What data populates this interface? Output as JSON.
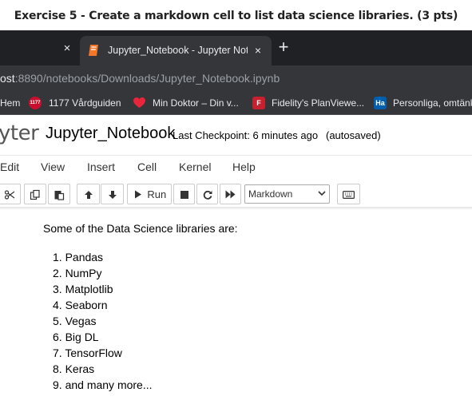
{
  "exercise": {
    "heading": "Exercise 5 - Create a markdown cell to list data science libraries. (3 pts)"
  },
  "browser": {
    "prev_tab_close": "×",
    "active_tab": {
      "title": "Jupyter_Notebook - Jupyter Note",
      "close": "×"
    },
    "new_tab": "+",
    "address": {
      "host": "ost",
      "path": ":8890/notebooks/Downloads/Jupyter_Notebook.ipynb"
    },
    "bookmarks": [
      {
        "label": "Hem",
        "icon": "home-icon"
      },
      {
        "label": "1177 Vårdguiden",
        "icon": "1177-logo-icon",
        "icon_text": "1177",
        "color": "#c8102e"
      },
      {
        "label": "Min Doktor – Din v...",
        "icon": "heart-icon",
        "color": "#e8253a"
      },
      {
        "label": "Fidelity's PlanViewe...",
        "icon": "fidelity-f-icon",
        "icon_text": "F",
        "color": "#c8202f"
      },
      {
        "label": "Personliga, omtänk",
        "icon": "handelsbanken-icon",
        "icon_text": "Ha",
        "color": "#005fad"
      }
    ]
  },
  "jupyter": {
    "logo_text": "yter",
    "notebook_name": "Jupyter_Notebook",
    "checkpoint": "Last Checkpoint: 6 minutes ago",
    "autosave": "(autosaved)",
    "menu": [
      "Edit",
      "View",
      "Insert",
      "Cell",
      "Kernel",
      "Help"
    ],
    "toolbar": {
      "run_label": "Run",
      "cell_type": "Markdown"
    }
  },
  "cell": {
    "intro": "Some of the Data Science libraries are:",
    "libraries": [
      "1. Pandas",
      "2. NumPy",
      "3. Matplotlib",
      "4. Seaborn",
      "5. Vegas",
      "6. Big DL",
      "7. TensorFlow",
      "8. Keras",
      "9. and many more..."
    ]
  }
}
